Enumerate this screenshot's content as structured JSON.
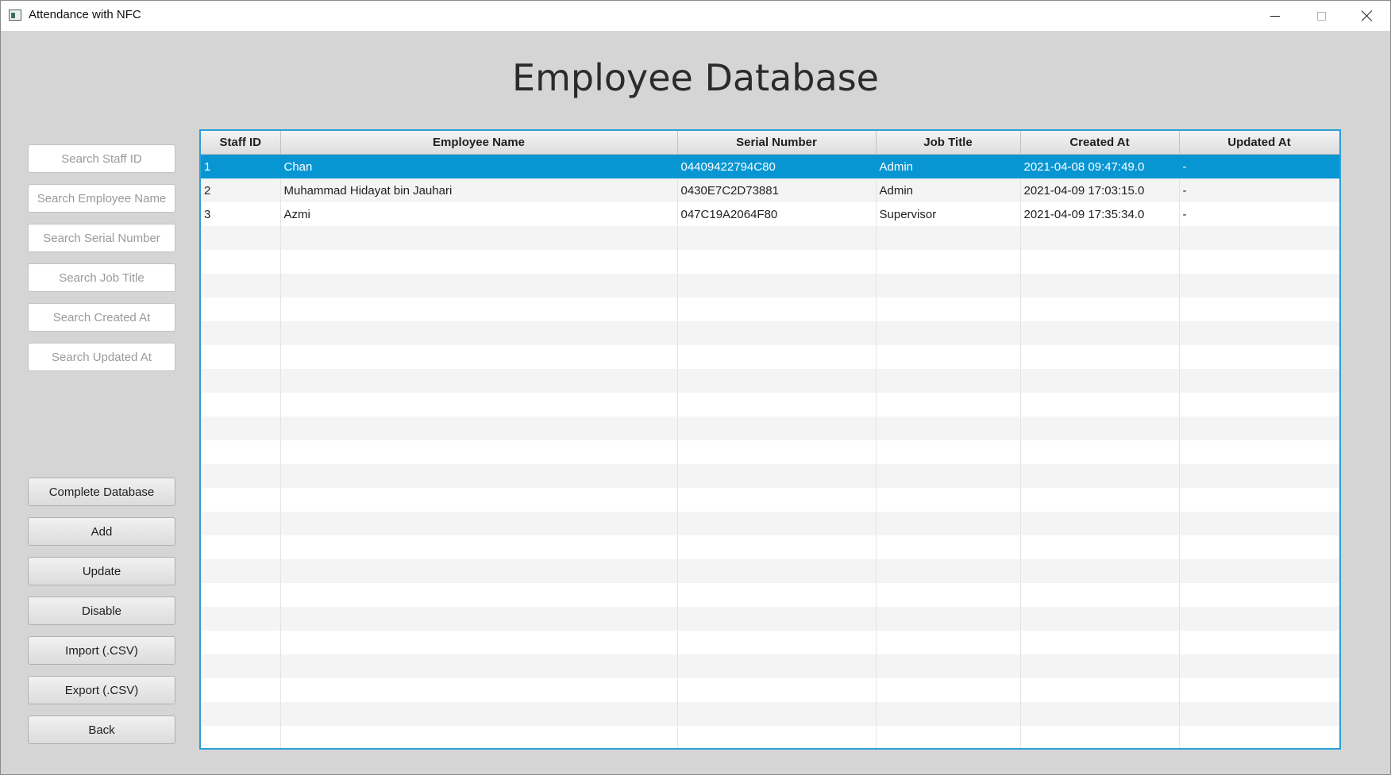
{
  "window": {
    "title": "Attendance with NFC",
    "controls": [
      "minimize-icon",
      "maximize-icon",
      "close-icon"
    ]
  },
  "page": {
    "title": "Employee Database"
  },
  "search": [
    {
      "placeholder": "Search Staff ID",
      "value": ""
    },
    {
      "placeholder": "Search Employee Name",
      "value": ""
    },
    {
      "placeholder": "Search Serial Number",
      "value": ""
    },
    {
      "placeholder": "Search Job Title",
      "value": ""
    },
    {
      "placeholder": "Search Created At",
      "value": ""
    },
    {
      "placeholder": "Search Updated At",
      "value": ""
    }
  ],
  "actions": [
    {
      "label": "Complete Database"
    },
    {
      "label": "Add"
    },
    {
      "label": "Update"
    },
    {
      "label": "Disable"
    },
    {
      "label": "Import (.CSV)"
    },
    {
      "label": "Export (.CSV)"
    },
    {
      "label": "Back"
    }
  ],
  "table": {
    "columns": [
      "Staff ID",
      "Employee Name",
      "Serial Number",
      "Job Title",
      "Created At",
      "Updated At"
    ],
    "selected_row": 0,
    "rows": [
      [
        "1",
        "Chan",
        "04409422794C80",
        "Admin",
        "2021-04-08 09:47:49.0",
        "-"
      ],
      [
        "2",
        "Muhammad Hidayat bin Jauhari",
        "0430E7C2D73881",
        "Admin",
        "2021-04-09 17:03:15.0",
        "-"
      ],
      [
        "3",
        "Azmi",
        "047C19A2064F80",
        "Supervisor",
        "2021-04-09 17:35:34.0",
        "-"
      ]
    ]
  },
  "colors": {
    "selection": "#0896d3",
    "table_border": "#2a9fd6",
    "background": "#d5d5d5"
  }
}
